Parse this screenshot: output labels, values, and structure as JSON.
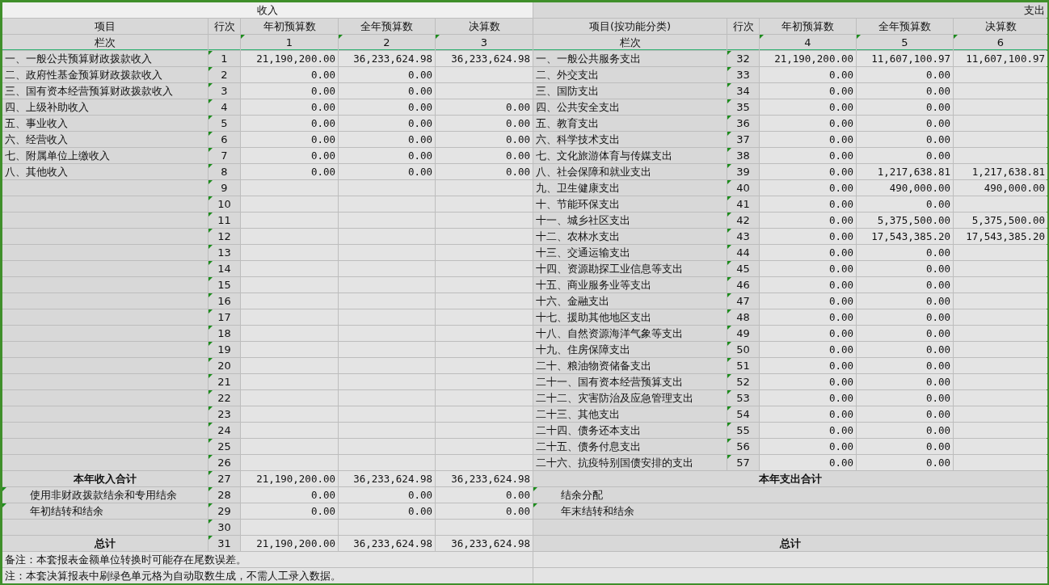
{
  "sheet": {
    "income_title": "收入",
    "expense_title": "支出",
    "left_headers": [
      "项目",
      "行次",
      "年初预算数",
      "全年预算数",
      "决算数"
    ],
    "right_headers": [
      "项目(按功能分类)",
      "行次",
      "年初预算数",
      "全年预算数",
      "决算数"
    ],
    "left_index": {
      "label": "栏次",
      "numbers": [
        {
          "text": "1",
          "flagged": true
        },
        {
          "text": "2",
          "flagged": true
        },
        {
          "text": "3",
          "flagged": true
        }
      ]
    },
    "right_index": {
      "label": "栏次",
      "numbers": [
        {
          "text": "4",
          "flagged": true
        },
        {
          "text": "5",
          "flagged": true
        },
        {
          "text": "6",
          "flagged": true
        }
      ]
    },
    "rows": [
      {
        "left": {
          "item": "一、一般公共预算财政拨款收入",
          "line": "1",
          "line_flagged": true,
          "initial": "21,190,200.00",
          "full_year": "36,233,624.98",
          "final": "36,233,624.98"
        },
        "right": {
          "item": "一、一般公共服务支出",
          "line": "32",
          "line_flagged": true,
          "initial": "21,190,200.00",
          "full_year": "11,607,100.97",
          "final": "11,607,100.97"
        }
      },
      {
        "left": {
          "item": "二、政府性基金预算财政拨款收入",
          "line": "2",
          "line_flagged": true,
          "initial": "0.00",
          "full_year": "0.00"
        },
        "right": {
          "item": "二、外交支出",
          "line": "33",
          "line_flagged": true,
          "initial": "0.00",
          "full_year": "0.00"
        }
      },
      {
        "left": {
          "item": "三、国有资本经营预算财政拨款收入",
          "line": "3",
          "line_flagged": true,
          "initial": "0.00",
          "full_year": "0.00"
        },
        "right": {
          "item": "三、国防支出",
          "line": "34",
          "line_flagged": true,
          "initial": "0.00",
          "full_year": "0.00"
        }
      },
      {
        "left": {
          "item": "四、上级补助收入",
          "line": "4",
          "line_flagged": true,
          "initial": "0.00",
          "full_year": "0.00",
          "final": "0.00"
        },
        "right": {
          "item": "四、公共安全支出",
          "line": "35",
          "line_flagged": true,
          "initial": "0.00",
          "full_year": "0.00"
        }
      },
      {
        "left": {
          "item": "五、事业收入",
          "line": "5",
          "line_flagged": true,
          "initial": "0.00",
          "full_year": "0.00",
          "final": "0.00"
        },
        "right": {
          "item": "五、教育支出",
          "line": "36",
          "line_flagged": true,
          "initial": "0.00",
          "full_year": "0.00"
        }
      },
      {
        "left": {
          "item": "六、经营收入",
          "line": "6",
          "line_flagged": true,
          "initial": "0.00",
          "full_year": "0.00",
          "final": "0.00"
        },
        "right": {
          "item": "六、科学技术支出",
          "line": "37",
          "line_flagged": true,
          "initial": "0.00",
          "full_year": "0.00"
        }
      },
      {
        "left": {
          "item": "七、附属单位上缴收入",
          "line": "7",
          "line_flagged": true,
          "initial": "0.00",
          "full_year": "0.00",
          "final": "0.00"
        },
        "right": {
          "item": "七、文化旅游体育与传媒支出",
          "line": "38",
          "line_flagged": true,
          "initial": "0.00",
          "full_year": "0.00"
        }
      },
      {
        "left": {
          "item": "八、其他收入",
          "line": "8",
          "line_flagged": true,
          "initial": "0.00",
          "full_year": "0.00",
          "final": "0.00"
        },
        "right": {
          "item": "八、社会保障和就业支出",
          "line": "39",
          "line_flagged": true,
          "initial": "0.00",
          "full_year": "1,217,638.81",
          "final": "1,217,638.81"
        }
      },
      {
        "left": {
          "line": "9",
          "line_flagged": true
        },
        "right": {
          "item": "九、卫生健康支出",
          "line": "40",
          "line_flagged": true,
          "initial": "0.00",
          "full_year": "490,000.00",
          "final": "490,000.00"
        }
      },
      {
        "left": {
          "line": "10",
          "line_flagged": true
        },
        "right": {
          "item": "十、节能环保支出",
          "line": "41",
          "line_flagged": true,
          "initial": "0.00",
          "full_year": "0.00"
        }
      },
      {
        "left": {
          "line": "11",
          "line_flagged": true
        },
        "right": {
          "item": "十一、城乡社区支出",
          "line": "42",
          "line_flagged": true,
          "initial": "0.00",
          "full_year": "5,375,500.00",
          "final": "5,375,500.00"
        }
      },
      {
        "left": {
          "line": "12",
          "line_flagged": true
        },
        "right": {
          "item": "十二、农林水支出",
          "line": "43",
          "line_flagged": true,
          "initial": "0.00",
          "full_year": "17,543,385.20",
          "final": "17,543,385.20"
        }
      },
      {
        "left": {
          "line": "13",
          "line_flagged": true
        },
        "right": {
          "item": "十三、交通运输支出",
          "line": "44",
          "line_flagged": true,
          "initial": "0.00",
          "full_year": "0.00"
        }
      },
      {
        "left": {
          "line": "14",
          "line_flagged": true
        },
        "right": {
          "item": "十四、资源勘探工业信息等支出",
          "line": "45",
          "line_flagged": true,
          "initial": "0.00",
          "full_year": "0.00"
        }
      },
      {
        "left": {
          "line": "15",
          "line_flagged": true
        },
        "right": {
          "item": "十五、商业服务业等支出",
          "line": "46",
          "line_flagged": true,
          "initial": "0.00",
          "full_year": "0.00"
        }
      },
      {
        "left": {
          "line": "16",
          "line_flagged": true
        },
        "right": {
          "item": "十六、金融支出",
          "line": "47",
          "line_flagged": true,
          "initial": "0.00",
          "full_year": "0.00"
        }
      },
      {
        "left": {
          "line": "17",
          "line_flagged": true
        },
        "right": {
          "item": "十七、援助其他地区支出",
          "line": "48",
          "line_flagged": true,
          "initial": "0.00",
          "full_year": "0.00"
        }
      },
      {
        "left": {
          "line": "18",
          "line_flagged": true
        },
        "right": {
          "item": "十八、自然资源海洋气象等支出",
          "line": "49",
          "line_flagged": true,
          "initial": "0.00",
          "full_year": "0.00"
        }
      },
      {
        "left": {
          "line": "19",
          "line_flagged": true
        },
        "right": {
          "item": "十九、住房保障支出",
          "line": "50",
          "line_flagged": true,
          "initial": "0.00",
          "full_year": "0.00"
        }
      },
      {
        "left": {
          "line": "20",
          "line_flagged": true
        },
        "right": {
          "item": "二十、粮油物资储备支出",
          "line": "51",
          "line_flagged": true,
          "initial": "0.00",
          "full_year": "0.00"
        }
      },
      {
        "left": {
          "line": "21",
          "line_flagged": true
        },
        "right": {
          "item": "二十一、国有资本经营预算支出",
          "line": "52",
          "line_flagged": true,
          "initial": "0.00",
          "full_year": "0.00"
        }
      },
      {
        "left": {
          "line": "22",
          "line_flagged": true
        },
        "right": {
          "item": "二十二、灾害防治及应急管理支出",
          "line": "53",
          "line_flagged": true,
          "initial": "0.00",
          "full_year": "0.00"
        }
      },
      {
        "left": {
          "line": "23",
          "line_flagged": true
        },
        "right": {
          "item": "二十三、其他支出",
          "line": "54",
          "line_flagged": true,
          "initial": "0.00",
          "full_year": "0.00"
        }
      },
      {
        "left": {
          "line": "24",
          "line_flagged": true
        },
        "right": {
          "item": "二十四、债务还本支出",
          "line": "55",
          "line_flagged": true,
          "initial": "0.00",
          "full_year": "0.00"
        }
      },
      {
        "left": {
          "line": "25",
          "line_flagged": true
        },
        "right": {
          "item": "二十五、债务付息支出",
          "line": "56",
          "line_flagged": true,
          "initial": "0.00",
          "full_year": "0.00"
        }
      },
      {
        "left": {
          "line": "26",
          "line_flagged": true
        },
        "right": {
          "item": "二十六、抗疫特别国债安排的支出",
          "line": "57",
          "line_flagged": true,
          "initial": "0.00",
          "full_year": "0.00"
        }
      }
    ],
    "totals": [
      {
        "left": {
          "kind": "total",
          "item": "本年收入合计",
          "line": "27",
          "line_flagged": true,
          "initial": "21,190,200.00",
          "full_year": "36,233,624.98",
          "final": "36,233,624.98"
        },
        "right": {
          "kind": "total",
          "item": "本年支出合计"
        }
      },
      {
        "left": {
          "kind": "sub",
          "item": "使用非财政拨款结余和专用结余",
          "item_flagged": true,
          "line": "28",
          "line_flagged": true,
          "initial": "0.00",
          "full_year": "0.00",
          "final": "0.00"
        },
        "right": {
          "kind": "sub",
          "item": "结余分配",
          "item_flagged": true
        }
      },
      {
        "left": {
          "kind": "sub",
          "item": "年初结转和结余",
          "item_flagged": true,
          "line": "29",
          "line_flagged": true,
          "initial": "0.00",
          "full_year": "0.00",
          "final": "0.00"
        },
        "right": {
          "kind": "sub",
          "item": "年末结转和结余",
          "item_flagged": true
        }
      },
      {
        "left": {
          "kind": "blank",
          "line": "30",
          "line_flagged": true
        },
        "right": {
          "kind": "blank"
        }
      },
      {
        "left": {
          "kind": "total",
          "item": "总计",
          "line": "31",
          "line_flagged": true,
          "initial": "21,190,200.00",
          "full_year": "36,233,624.98",
          "final": "36,233,624.98"
        },
        "right": {
          "kind": "total",
          "item": "总计"
        }
      }
    ],
    "notes": [
      "备注：本套报表金额单位转换时可能存在尾数误差。",
      "注：本套决算报表中刷绿色单元格为自动取数生成，不需人工录入数据。"
    ]
  }
}
